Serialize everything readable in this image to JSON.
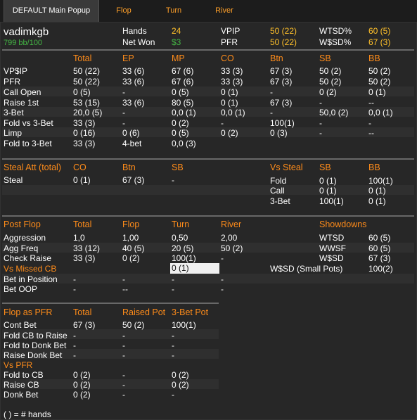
{
  "tabs": [
    {
      "label": "DEFAULT Main Popup",
      "active": true
    },
    {
      "label": "Flop",
      "active": false
    },
    {
      "label": "Turn",
      "active": false
    },
    {
      "label": "River",
      "active": false
    }
  ],
  "player": {
    "name": "vadimkgb",
    "winrate": "799 bb/100"
  },
  "summary": {
    "hands_label": "Hands",
    "hands_value": "24",
    "netwon_label": "Net Won",
    "netwon_value": "$3",
    "vpip_label": "VPIP",
    "vpip_value": "50 (22)",
    "pfr_label": "PFR",
    "pfr_value": "50 (22)",
    "wtsd_label": "WTSD%",
    "wtsd_value": "60 (5)",
    "wsd_label": "W$SD%",
    "wsd_value": "67 (3)"
  },
  "preflop": {
    "headers": [
      "Total",
      "EP",
      "MP",
      "CO",
      "Btn",
      "SB",
      "BB"
    ],
    "rows": [
      {
        "label": "VP$IP",
        "cells": [
          "50 (22)",
          "33 (6)",
          "67 (6)",
          "33 (3)",
          "67 (3)",
          "50 (2)",
          "50 (2)"
        ]
      },
      {
        "label": "PFR",
        "cells": [
          "50 (22)",
          "33 (6)",
          "67 (6)",
          "33 (3)",
          "67 (3)",
          "50 (2)",
          "50 (2)"
        ]
      },
      {
        "label": "Call Open",
        "cells": [
          "0 (5)",
          "-",
          "0 (5)",
          "0 (1)",
          "-",
          "0 (2)",
          "0 (1)"
        ]
      },
      {
        "label": "Raise 1st",
        "cells": [
          "53 (15)",
          "33 (6)",
          "80 (5)",
          "0 (1)",
          "67 (3)",
          "-",
          "--"
        ]
      },
      {
        "label": "3-Bet",
        "cells": [
          "20,0 (5)",
          "-",
          "0,0 (1)",
          "0,0 (1)",
          "-",
          "50,0 (2)",
          "0,0 (1)"
        ]
      },
      {
        "label": "Fold vs 3-Bet",
        "cells": [
          "33 (3)",
          "-",
          "0 (2)",
          "-",
          "100(1)",
          "-",
          "-"
        ]
      },
      {
        "label": "Limp",
        "cells": [
          "0 (16)",
          "0 (6)",
          "0 (5)",
          "0 (2)",
          "0 (3)",
          "-",
          "--"
        ]
      },
      {
        "label": "Fold to 3-Bet",
        "cells": [
          "33 (3)",
          "4-bet",
          "0,0 (3)",
          "",
          "",
          "",
          ""
        ]
      }
    ]
  },
  "steal": {
    "title": "Steal Att (total)",
    "headers": [
      "CO",
      "Btn",
      "SB"
    ],
    "row_label": "Steal",
    "cells": [
      "0 (1)",
      "67 (3)",
      "-"
    ],
    "vs_title": "Vs Steal",
    "vs_headers": [
      "SB",
      "BB"
    ],
    "vs_rows": [
      {
        "label": "Fold",
        "cells": [
          "0 (1)",
          "100(1)"
        ]
      },
      {
        "label": "Call",
        "cells": [
          "0 (1)",
          "0 (1)"
        ]
      },
      {
        "label": "3-Bet",
        "cells": [
          "100(1)",
          "0 (1)"
        ]
      }
    ]
  },
  "postflop": {
    "title": "Post Flop",
    "headers": [
      "Total",
      "Flop",
      "Turn",
      "River"
    ],
    "rows": [
      {
        "label": "Aggression",
        "cells": [
          "1,0",
          "1,00",
          "0,50",
          "2,00"
        ]
      },
      {
        "label": "Agg Freq",
        "cells": [
          "33 (12)",
          "40 (5)",
          "20 (5)",
          "50 (2)"
        ]
      },
      {
        "label": "Check Raise",
        "cells": [
          "33 (3)",
          "0 (2)",
          "100(1)",
          "-"
        ]
      }
    ],
    "missed_cb_title": "Vs Missed CB",
    "missed_cb_value": "0 (1)",
    "pos_rows": [
      {
        "label": "Bet in Position",
        "cells": [
          "-",
          "-",
          "-",
          "-"
        ]
      },
      {
        "label": "Bet OOP",
        "cells": [
          "-",
          "--",
          "-",
          "-"
        ]
      }
    ],
    "showdowns_title": "Showdowns",
    "showdowns": [
      {
        "label": "WTSD",
        "value": "60 (5)"
      },
      {
        "label": "WWSF",
        "value": "60 (5)"
      },
      {
        "label": "W$SD",
        "value": "67 (3)"
      },
      {
        "label": "W$SD (Small Pots)",
        "value": "100(2)"
      }
    ]
  },
  "pfr_flop": {
    "title": "Flop as PFR",
    "headers": [
      "Total",
      "Raised Pot",
      "3-Bet Pot"
    ],
    "rows": [
      {
        "label": "Cont Bet",
        "cells": [
          "67 (3)",
          "50 (2)",
          "100(1)"
        ]
      },
      {
        "label": "Fold CB to Raise",
        "cells": [
          "-",
          "-",
          "-"
        ]
      },
      {
        "label": "Fold to Donk Bet",
        "cells": [
          "-",
          "-",
          "-"
        ]
      },
      {
        "label": "Raise Donk Bet",
        "cells": [
          "-",
          "-",
          "-"
        ]
      }
    ],
    "vs_title": "Vs PFR",
    "vs_rows": [
      {
        "label": "Fold to CB",
        "cells": [
          "0 (2)",
          "-",
          "0 (2)"
        ]
      },
      {
        "label": "Raise CB",
        "cells": [
          "0 (2)",
          "-",
          "0 (2)"
        ]
      },
      {
        "label": "Donk Bet",
        "cells": [
          "0 (2)",
          "-",
          "-"
        ]
      }
    ]
  },
  "footer": "( ) = # hands"
}
